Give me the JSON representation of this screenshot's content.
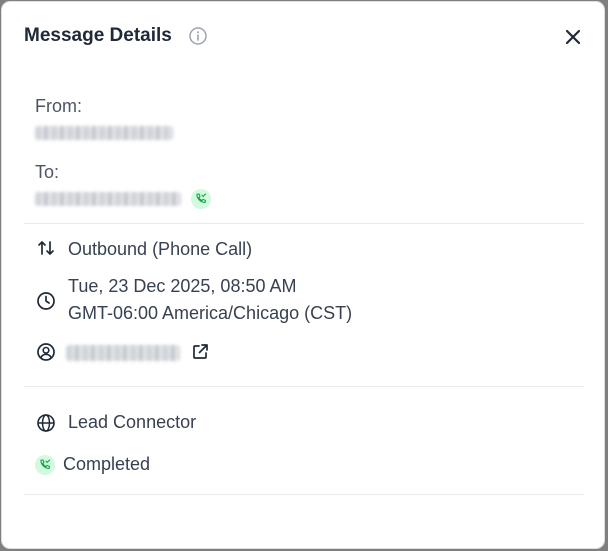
{
  "dialog": {
    "title": "Message Details"
  },
  "from": {
    "label": "From:"
  },
  "to": {
    "label": "To:"
  },
  "direction": {
    "text": "Outbound (Phone Call)"
  },
  "datetime": {
    "date": "Tue, 23 Dec 2025, 08:50 AM",
    "timezone": "GMT-06:00 America/Chicago (CST)"
  },
  "source": {
    "text": "Lead Connector"
  },
  "status": {
    "text": "Completed"
  },
  "colors": {
    "accent_green": "#16a34a",
    "badge_bg": "#d1fadf"
  }
}
